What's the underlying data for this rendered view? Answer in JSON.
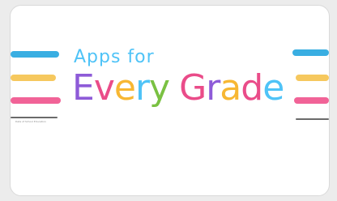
{
  "card": {
    "subtitle": "Apps for",
    "title_letters": [
      "E",
      "v",
      "e",
      "r",
      "y",
      " ",
      "G",
      "r",
      "a",
      "d",
      "e"
    ],
    "footnote": "Data of School Education",
    "colors": {
      "subtitle": "#4fc3f7",
      "E": "#8e5bd8",
      "v": "#ea4c89",
      "e": "#f7b733",
      "r": "#4fc3f7",
      "y": "#7ac142",
      "G": "#ea4c89",
      "r2": "#8e5bd8",
      "a": "#f7b733",
      "d": "#ea4c89",
      "e2": "#4fc3f7",
      "stroke_blue": "#29a8e0",
      "stroke_yellow": "#f6c451",
      "stroke_pink": "#f0568f",
      "stroke_gray": "#6b6b6b"
    }
  }
}
